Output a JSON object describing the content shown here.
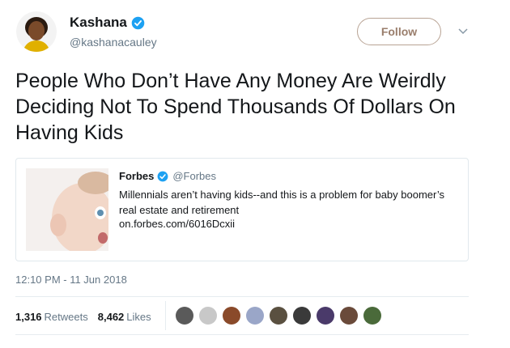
{
  "user": {
    "name": "Kashana",
    "handle": "@kashanacauley",
    "avatar_icon": "profile-avatar",
    "verified_icon": "verified-badge-icon"
  },
  "follow_label": "Follow",
  "tweet_text": "People Who Don’t Have Any Money Are Weirdly Deciding Not To Spend Thousands Of Dollars On Having Kids",
  "card": {
    "name": "Forbes",
    "handle": "@Forbes",
    "text": "Millennials aren’t having kids--and this is a problem for baby boomer’s real estate and retirement",
    "link": "on.forbes.com/6016Dcxii"
  },
  "timestamp": "12:10 PM - 11 Jun 2018",
  "stats": {
    "retweets_count": "1,316",
    "retweets_label": "Retweets",
    "likes_count": "8,462",
    "likes_label": "Likes"
  },
  "likers_colors": [
    "#5a5a5a",
    "#c8c8c8",
    "#8a4a2a",
    "#9aa6c8",
    "#5a5040",
    "#3a3a3a",
    "#4a3a6a",
    "#6a4a3a",
    "#4a6a3a"
  ],
  "colors": {
    "verified": "#1da1f2",
    "follow_border": "#b8a394"
  }
}
